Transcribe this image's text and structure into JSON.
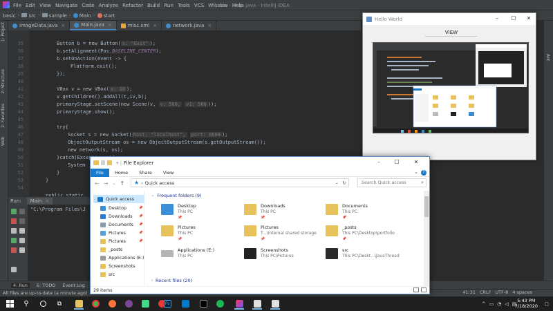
{
  "ide": {
    "menu": [
      "File",
      "Edit",
      "View",
      "Navigate",
      "Code",
      "Analyze",
      "Refactor",
      "Build",
      "Run",
      "Tools",
      "VCS",
      "Window",
      "Help"
    ],
    "window_title": "basic - Main.java - IntelliJ IDEA",
    "breadcrumbs": [
      "basic",
      "src",
      "sample",
      "Main",
      "start"
    ],
    "tabs": [
      {
        "label": "imageData.java",
        "kind": "class"
      },
      {
        "label": "Main.java",
        "kind": "class"
      },
      {
        "label": "misc.xml",
        "kind": "xml"
      },
      {
        "label": "network.java",
        "kind": "class"
      }
    ],
    "left_strip": [
      "1: Project",
      "2: Structure",
      "2: Favorites",
      "Web"
    ],
    "right_strip": [
      "Ant"
    ],
    "line_numbers": [
      "35",
      "36",
      "37",
      "38",
      "39",
      "40",
      "41",
      "42",
      "43",
      "44",
      "45",
      "46",
      "47",
      "48",
      "49",
      "50",
      "51",
      "52",
      "53",
      "54",
      "55"
    ],
    "code": {
      "l35": "Button b = new Button(",
      "l35_hint": "s: \"Exit\"",
      "l35_end": ");",
      "l36": "b.setAlignment(Pos.",
      "l36_const": "BASELINE_CENTER",
      "l36_end": ");",
      "l37": "b.setOnAction(event -> {",
      "l38": "Platform.exit();",
      "l39": "});",
      "l41": "VBox v = new VBox(",
      "l41_hint": "v: 10",
      "l41_end": ");",
      "l42": "v.getChildren().addAll(t,iv,b);",
      "l43": "primaryStage.setScene(new Scene(v,",
      "l43_hint1": "v: 500,",
      "l43_hint2": "v1: 500",
      "l43_end": "));",
      "l44": "primaryStage.show();",
      "l46": "try{",
      "l47": "Socket s = new Socket(",
      "l47_hint1": "host: \"localhost\",",
      "l47_hint2": "port: 8888",
      "l47_end": ");",
      "l48": "ObjectOutputStream os = new ObjectOutputStream(s.getOutputStream());",
      "l49": "new network(s, os);",
      "l50": "}catch(Exception e){",
      "l51": "System",
      "l52": "}",
      "l53": "}",
      "l55": "public static"
    },
    "run": {
      "label": "Run:",
      "tab": "Main",
      "command": "\"C:\\Program Files\\J"
    },
    "bottom_tabs": [
      "4: Run",
      "6: TODO",
      "Event Log"
    ],
    "status": "All files are up-to-date (a minute ago)",
    "status_right": [
      "41:31",
      "CRLF",
      "UTF-8",
      "4 spaces"
    ]
  },
  "hello_window": {
    "title": "Hello World",
    "button": "VIEW"
  },
  "explorer": {
    "title": "File Explorer",
    "ribbon": [
      "File",
      "Home",
      "Share",
      "View"
    ],
    "address": "Quick access",
    "search_placeholder": "Search Quick access",
    "nav": [
      {
        "label": "Quick access",
        "icon": "star-icon",
        "pinned": false,
        "selected": true
      },
      {
        "label": "Desktop",
        "icon": "desktop-icon",
        "pinned": true
      },
      {
        "label": "Downloads",
        "icon": "downloads-icon",
        "pinned": true
      },
      {
        "label": "Documents",
        "icon": "documents-icon",
        "pinned": true
      },
      {
        "label": "Pictures",
        "icon": "pictures-icon",
        "pinned": true
      },
      {
        "label": "Pictures",
        "icon": "folder-icon",
        "pinned": true
      },
      {
        "label": "_posts",
        "icon": "folder-icon",
        "pinned": false
      },
      {
        "label": "Applications (E:)",
        "icon": "drive-icon",
        "pinned": false
      },
      {
        "label": "Screenshots",
        "icon": "folder-icon",
        "pinned": false
      },
      {
        "label": "src",
        "icon": "folder-icon",
        "pinned": false
      }
    ],
    "frequent_header": "Frequent folders (9)",
    "recent_header": "Recent files (20)",
    "folders": [
      {
        "name": "Desktop",
        "sub": "This PC"
      },
      {
        "name": "Downloads",
        "sub": "This PC"
      },
      {
        "name": "Documents",
        "sub": "This PC"
      },
      {
        "name": "Pictures",
        "sub": "This PC"
      },
      {
        "name": "Pictures",
        "sub": "T...\\Internal shared storage"
      },
      {
        "name": "_posts",
        "sub": "This PC\\Desktop\\portfolio"
      },
      {
        "name": "Applications (E:)",
        "sub": "This PC"
      },
      {
        "name": "Screenshots",
        "sub": "This PC\\Pictures"
      },
      {
        "name": "src",
        "sub": "This PC\\Deskt...\\JavaThread"
      }
    ],
    "item_count": "29 items"
  },
  "clock": {
    "time": "5:43 PM",
    "date": "7/18/2020"
  }
}
